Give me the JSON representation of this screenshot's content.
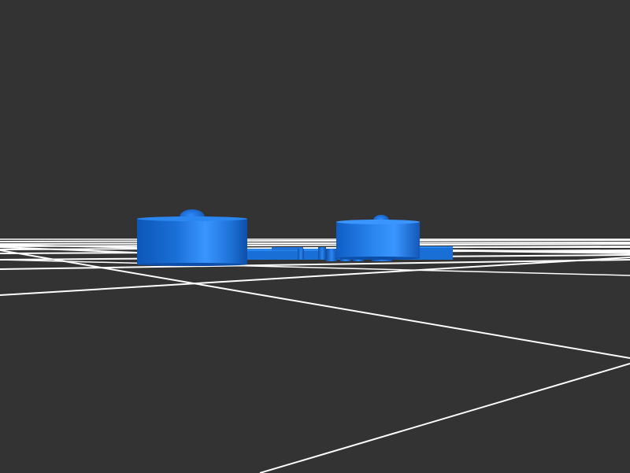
{
  "scene": {
    "background_color": "#333333",
    "grid_color": "#ffffff",
    "object_color": "#1a6fd6",
    "object_highlight_color": "#3a95ff",
    "object_shadow_color": "#0d4fa8",
    "objects": [
      "large-cylinder",
      "small-cylinder",
      "connector-plate",
      "small-posts",
      "hemisphere-bumps"
    ]
  }
}
